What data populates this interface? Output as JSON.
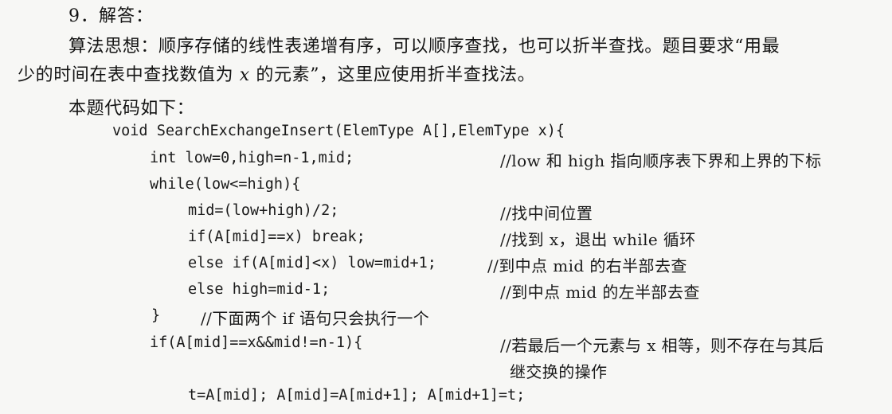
{
  "section": {
    "heading": "9．解答：",
    "idea_line1": "算法思想：顺序存储的线性表递增有序，可以顺序查找，也可以折半查找。题目要求“用最",
    "idea_line2_a": "少的时间在表中查找数值为 ",
    "idea_line2_x": "x",
    "idea_line2_b": " 的元素”，这里应使用折半查找法。",
    "code_intro": "本题代码如下："
  },
  "code": {
    "l1": "void SearchExchangeInsert(ElemType A[],ElemType x){",
    "l2": "int low=0,high=n-1,mid;",
    "c2": "//low 和 high 指向顺序表下界和上界的下标",
    "l3": "while(low<=high){",
    "l4": "mid=(low+high)/2;",
    "c4": "//找中间位置",
    "l5": "if(A[mid]==x) break;",
    "c5": "//找到 x，退出 while 循环",
    "l6": "else if(A[mid]<x) low=mid+1;",
    "c6": "//到中点 mid 的右半部去查",
    "l7": "else high=mid-1;",
    "c7": "//到中点 mid 的左半部去查",
    "l8": "}",
    "c8": "//下面两个 if 语句只会执行一个",
    "l9": "if(A[mid]==x&&mid!=n-1){",
    "c9a": "//若最后一个元素与 x 相等，则不存在与其后",
    "c9b": "继交换的操作",
    "l10": "t=A[mid]; A[mid]=A[mid+1]; A[mid+1]=t;"
  }
}
